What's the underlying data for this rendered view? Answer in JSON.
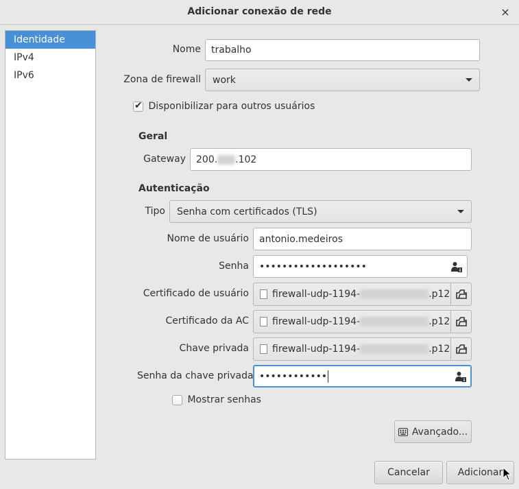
{
  "window": {
    "title": "Adicionar conexão de rede",
    "close_glyph": "×"
  },
  "sidebar": {
    "items": [
      {
        "label": "Identidade",
        "selected": true
      },
      {
        "label": "IPv4",
        "selected": false
      },
      {
        "label": "IPv6",
        "selected": false
      }
    ]
  },
  "form": {
    "name_label": "Nome",
    "name_value": "trabalho",
    "firewall_label": "Zona de firewall",
    "firewall_value": "work",
    "share_label": "Disponibilizar para outros usuários",
    "share_checked": true,
    "general_title": "Geral",
    "gateway_label": "Gateway",
    "gateway_prefix": "200.",
    "gateway_suffix": ".102",
    "auth_title": "Autenticação",
    "type_label": "Tipo",
    "type_value": "Senha com certificados (TLS)",
    "username_label": "Nome de usuário",
    "username_value": "antonio.medeiros",
    "password_label": "Senha",
    "password_value": "•••••••••••••••••••",
    "user_cert_label": "Certificado de usuário",
    "user_cert_prefix": "firewall-udp-1194-",
    "user_cert_suffix": ".p12",
    "ca_cert_label": "Certificado da AC",
    "ca_cert_prefix": "firewall-udp-1194-",
    "ca_cert_suffix": ".p12",
    "private_key_label": "Chave privada",
    "private_key_prefix": "firewall-udp-1194-",
    "private_key_suffix": ".p12",
    "key_password_label": "Senha da chave privada",
    "key_password_value": "••••••••••••",
    "show_passwords_label": "Mostrar senhas",
    "show_passwords_checked": false,
    "advanced_label": "Avançado..."
  },
  "footer": {
    "cancel_label": "Cancelar",
    "add_label": "Adicionar"
  },
  "colors": {
    "accent": "#4a90d9",
    "background": "#e8e8e7"
  }
}
